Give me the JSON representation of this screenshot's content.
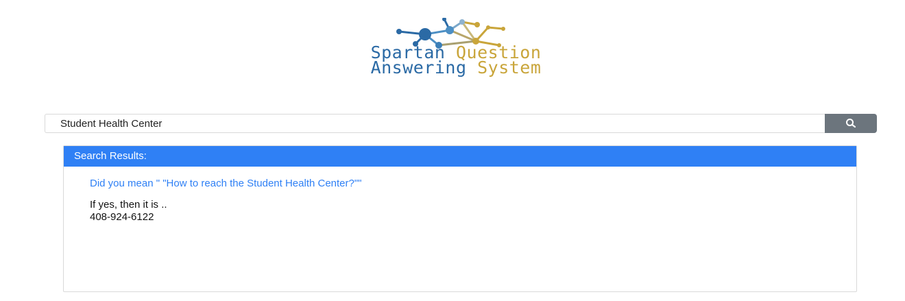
{
  "logo": {
    "line1_part1": "Spartan",
    "line1_part2": " Question",
    "line2_part1": "Answering",
    "line2_part2": " System"
  },
  "search": {
    "value": "Student Health Center",
    "button_icon": "search-icon"
  },
  "results": {
    "header": "Search Results:",
    "suggestion": "Did you mean \" \"How to reach the Student Health Center?\"\"",
    "answer_intro": "If yes, then it is ..",
    "answer_value": "408-924-6122"
  },
  "colors": {
    "logo_blue": "#2b6aa5",
    "logo_gold": "#c9a53a",
    "header_blue": "#2f80f5",
    "button_gray": "#6c757d"
  }
}
